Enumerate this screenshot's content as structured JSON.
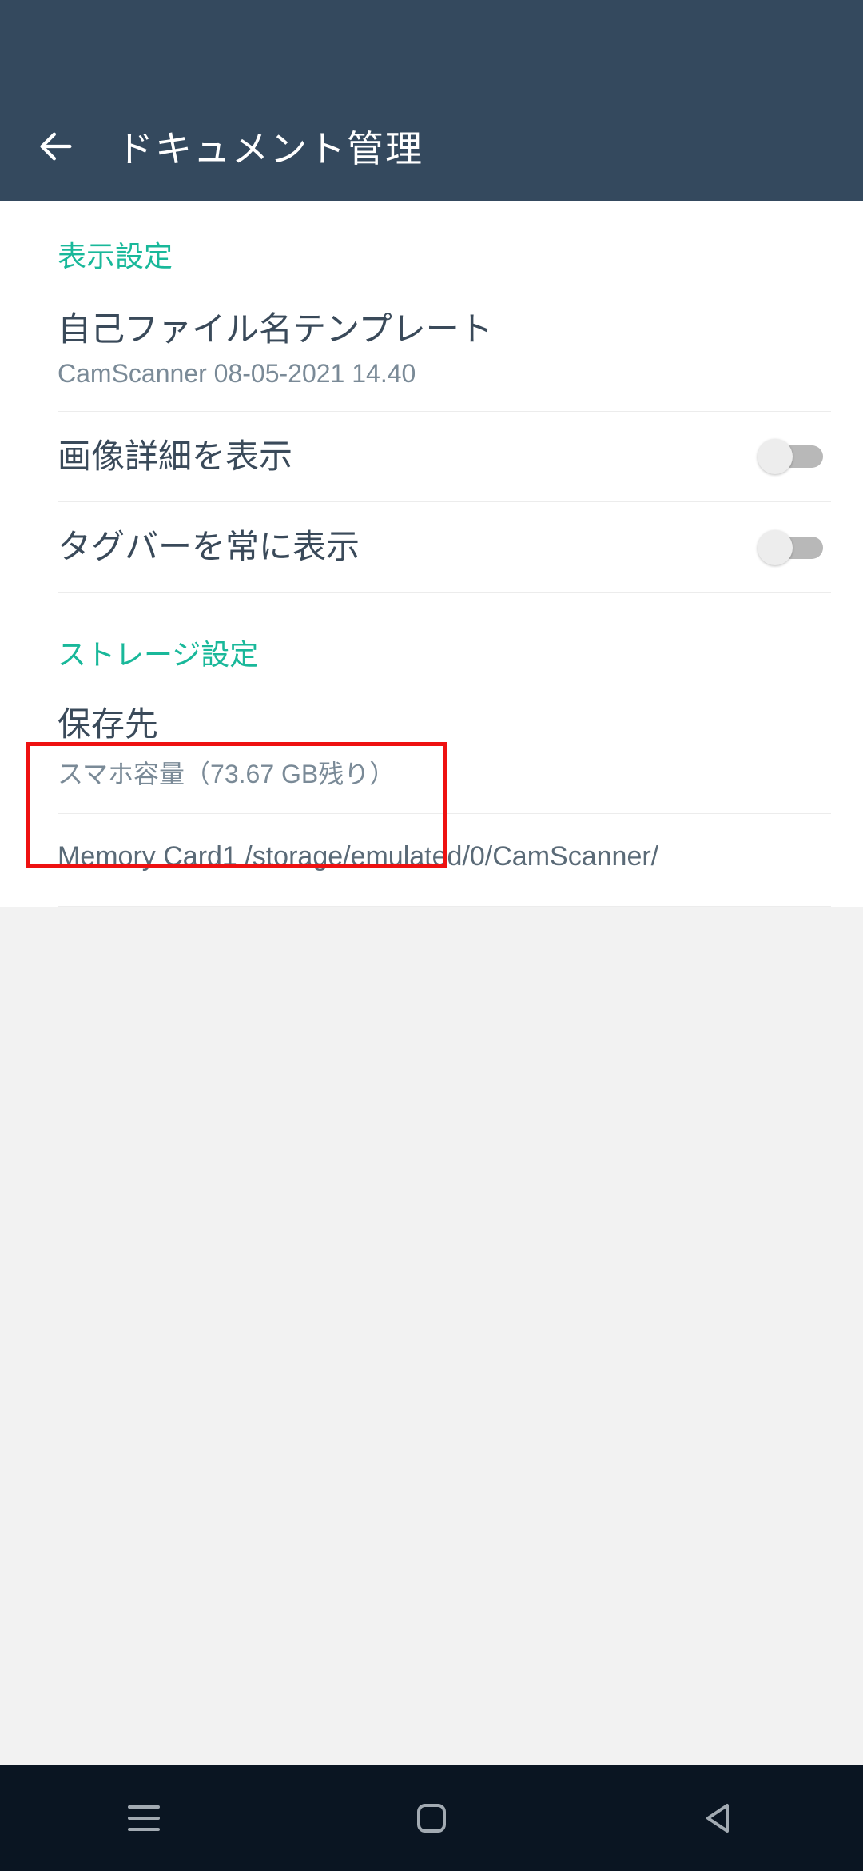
{
  "appbar": {
    "title": "ドキュメント管理"
  },
  "sections": {
    "display": {
      "header": "表示設定",
      "template": {
        "title": "自己ファイル名テンプレート",
        "sub": "CamScanner 08-05-2021 14.40"
      },
      "showImageDetail": {
        "title": "画像詳細を表示",
        "value": false
      },
      "alwaysShowTagBar": {
        "title": "タグバーを常に表示",
        "value": false
      }
    },
    "storage": {
      "header": "ストレージ設定",
      "saveTo": {
        "title": "保存先",
        "sub": "スマホ容量（73.67 GB残り）"
      },
      "path": "Memory Card1 /storage/emulated/0/CamScanner/"
    }
  }
}
